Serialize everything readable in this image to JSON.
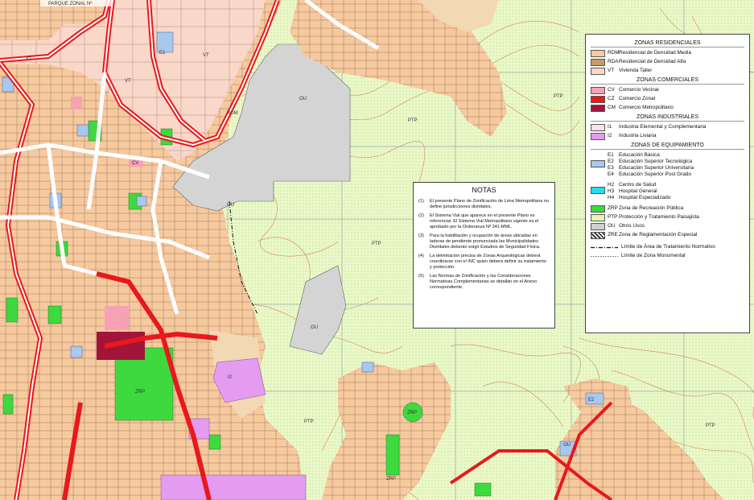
{
  "map": {
    "top_label": "PARQUE ZONAL Nº",
    "zone_labels": {
      "vt": "VT",
      "rdm": "RDM",
      "ou": "OU",
      "ptp": "PTP",
      "zrp": "ZRP",
      "e1": "E1",
      "e2": "E2",
      "cv": "CV",
      "i2": "I2"
    }
  },
  "legend": {
    "residential": {
      "title": "ZONAS RESIDENCIALES",
      "items": [
        {
          "code": "RDM",
          "label": "Residencial de Densidad Media",
          "color": "#f7c99f"
        },
        {
          "code": "RDA",
          "label": "Residencial de Densidad Alta",
          "color": "#c79a68"
        },
        {
          "code": "VT",
          "label": "Vivienda Taller",
          "color": "#f9d7c9"
        }
      ]
    },
    "commercial": {
      "title": "ZONAS COMERCIALES",
      "items": [
        {
          "code": "CV",
          "label": "Comercio Vecinal",
          "color": "#f6a1b4"
        },
        {
          "code": "CZ",
          "label": "Comercio Zonal",
          "color": "#e8181c"
        },
        {
          "code": "CM",
          "label": "Comercio Metropolitano",
          "color": "#a3143a"
        }
      ]
    },
    "industrial": {
      "title": "ZONAS INDUSTRIALES",
      "items": [
        {
          "code": "I1",
          "label": "Industria Elemental y Complementaria",
          "color": "#f8e2f0"
        },
        {
          "code": "I2",
          "label": "Industria Liviana",
          "color": "#e39cf0"
        }
      ]
    },
    "equipment": {
      "title": "ZONAS DE EQUIPAMIENTO",
      "education": {
        "color": "#a7c8ef",
        "codes": [
          "E1",
          "E2",
          "E3",
          "E4"
        ],
        "labels": [
          "Educación Básica",
          "Educación Superior Tecnológica",
          "Educación Superior Universitaria",
          "Educación Superior Post Grado"
        ]
      },
      "health": {
        "color": "#27dce8",
        "codes": [
          "H2",
          "H3",
          "H4"
        ],
        "labels": [
          "Centro de Salud",
          "Hospital General",
          "Hospital Especializado"
        ]
      },
      "items": [
        {
          "code": "ZRP",
          "label": "Zona de Recreación Pública",
          "color": "#3ed93e"
        },
        {
          "code": "PTP",
          "label": "Protección y Tratamiento Paisajista",
          "color": "#e3f7b2"
        },
        {
          "code": "OU",
          "label": "Otros Usos",
          "color": "#cfcfcf"
        },
        {
          "code": "ZRE",
          "label": "Zona de Reglamentación Especial",
          "color": "#ffffff"
        }
      ]
    },
    "lines": [
      {
        "label": "Límite de Área de Tratamiento Normativo"
      },
      {
        "label": "Límite de Zona Monumental"
      }
    ]
  },
  "notes": {
    "title": "NOTAS",
    "items": [
      {
        "num": "(1)",
        "text": "El presente Plano de Zonificación de Lima Metropolitana no define jurisdicciones distritales."
      },
      {
        "num": "(2)",
        "text": "El Sistema Vial que aparece en el presente Plano es referencial. El Sistema Vial Metropolitano vigente es el aprobado por la Ordenanza Nº 341-MML."
      },
      {
        "num": "(3)",
        "text": "Para la habilitación y ocupación de áreas ubicadas en laderas de pendiente pronunciada las Municipalidades Distritales deberán exigir Estudios de Seguridad Física."
      },
      {
        "num": "(4)",
        "text": "La delimitación precisa de Zonas Arqueológicas deberá coordinarse con el INC quien deberá definir su tratamiento y protección."
      },
      {
        "num": "(5)",
        "text": "Las Normas de Zonificación y las Consideraciones Normativas Complementarias se detallan en el Anexo correspondiente."
      }
    ]
  }
}
